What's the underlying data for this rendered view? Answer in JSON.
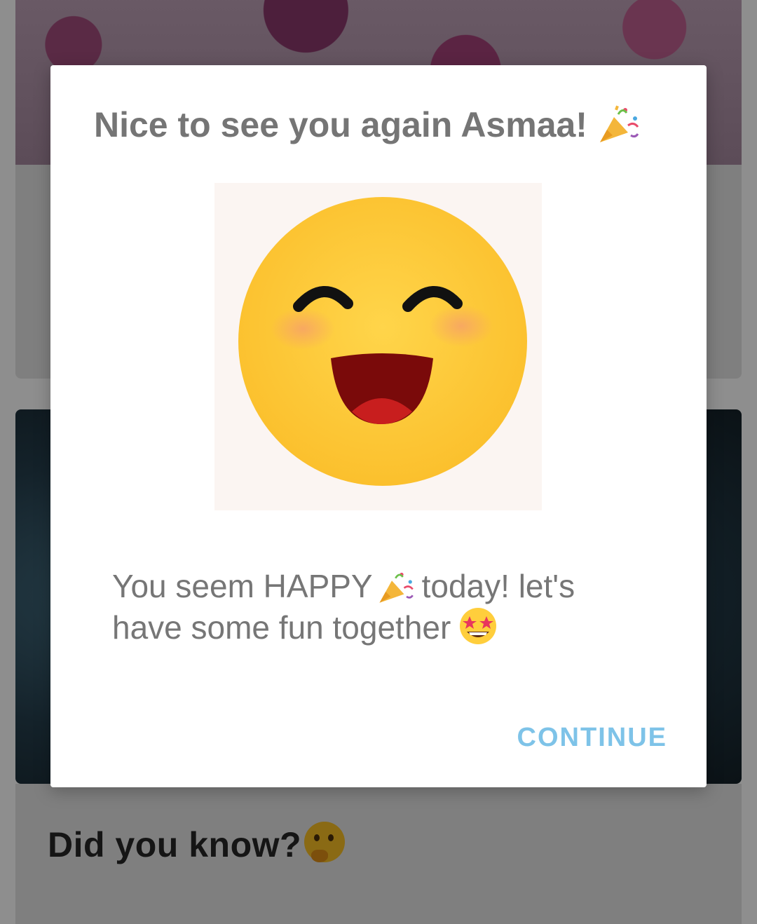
{
  "background": {
    "section_heading": "Did you know?"
  },
  "dialog": {
    "title": "Nice to see you again Asmaa!",
    "title_icon": "party-popper-icon",
    "image": "happy-face-emoji",
    "message_part1": "You seem HAPPY",
    "message_icon1": "party-popper-icon",
    "message_part2": "today! let's have some fun together",
    "message_icon2": "star-struck-icon",
    "continue_label": "CONTINUE"
  },
  "colors": {
    "title": "#757575",
    "message": "#767676",
    "accent": "#7ec3e8",
    "emoji_face": "#FFCE3C",
    "emoji_mouth": "#7A0A0A"
  }
}
